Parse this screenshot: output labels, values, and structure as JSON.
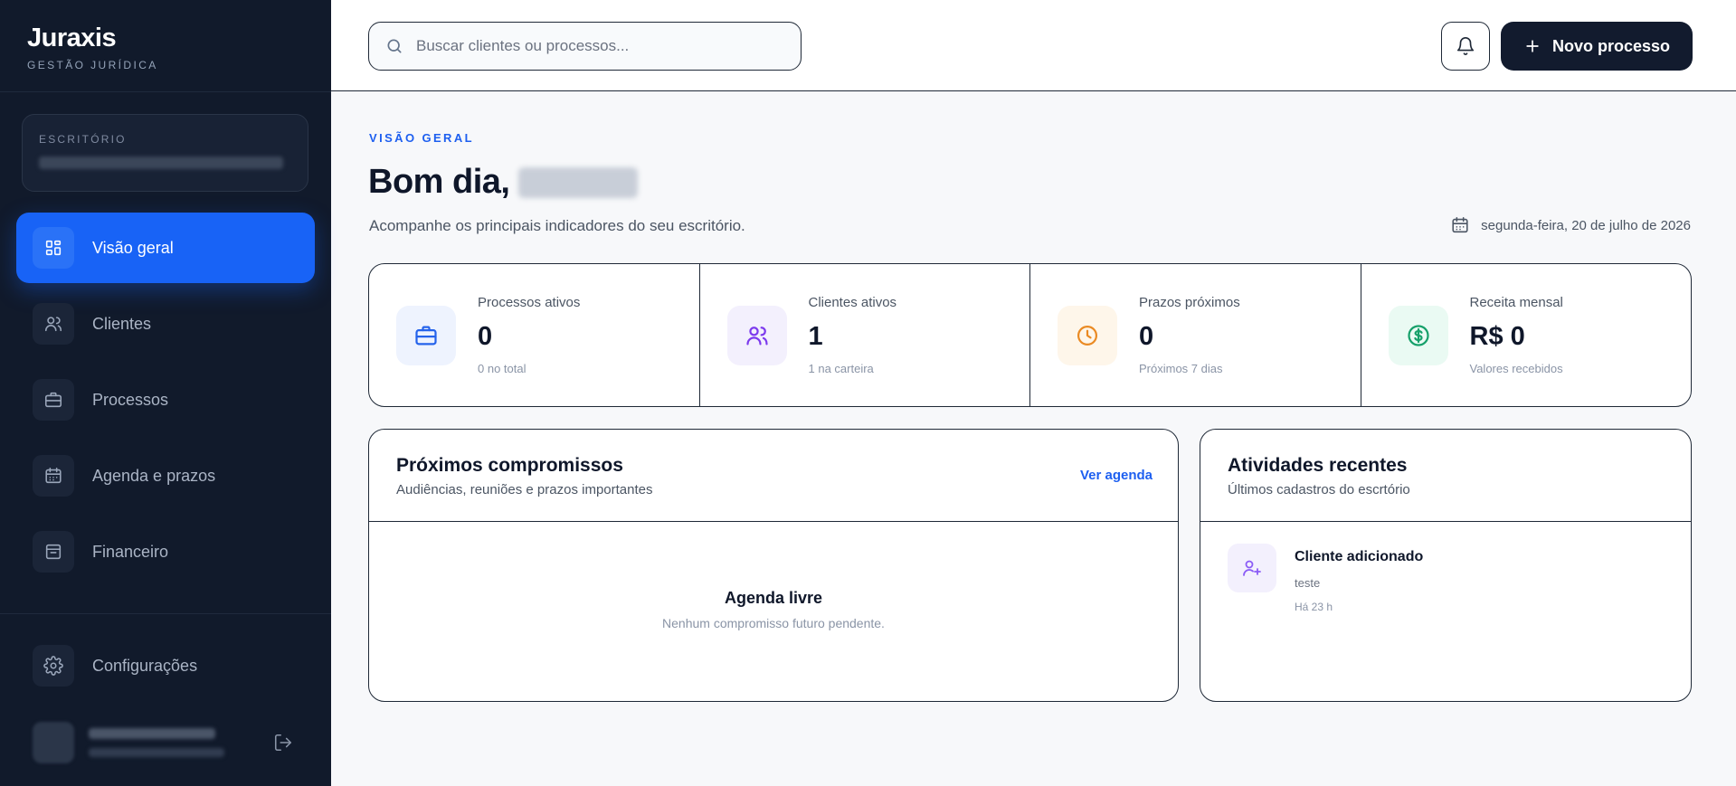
{
  "brand": {
    "name": "Juraxis",
    "subtitle": "GESTÃO JURÍDICA"
  },
  "office": {
    "label": "ESCRITÓRIO"
  },
  "nav": {
    "items": [
      {
        "label": "Visão geral",
        "icon": "layout-grid-icon",
        "active": true
      },
      {
        "label": "Clientes",
        "icon": "users-icon"
      },
      {
        "label": "Processos",
        "icon": "briefcase-icon"
      },
      {
        "label": "Agenda e prazos",
        "icon": "calendar-icon"
      },
      {
        "label": "Financeiro",
        "icon": "wallet-icon"
      }
    ],
    "settings_label": "Configurações"
  },
  "header": {
    "search_placeholder": "Buscar clientes ou processos...",
    "new_button_label": "Novo processo"
  },
  "page": {
    "eyebrow": "VISÃO GERAL",
    "greeting": "Bom dia,",
    "subtitle": "Acompanhe os principais indicadores do seu escritório.",
    "date": "segunda-feira, 20 de julho de 2026"
  },
  "stats": [
    {
      "label": "Processos ativos",
      "value": "0",
      "note": "0 no total",
      "icon": "briefcase-icon",
      "color": "#2563eb",
      "bg": "#eef3fe"
    },
    {
      "label": "Clientes ativos",
      "value": "1",
      "note": "1 na carteira",
      "icon": "users-icon",
      "color": "#7c3aed",
      "bg": "#f3f0fd"
    },
    {
      "label": "Prazos próximos",
      "value": "0",
      "note": "Próximos 7 dias",
      "icon": "clock-icon",
      "color": "#ea8a23",
      "bg": "#fef6ea"
    },
    {
      "label": "Receita mensal",
      "value": "R$ 0",
      "note": "Valores recebidos",
      "icon": "dollar-icon",
      "color": "#16a06a",
      "bg": "#eafaf3"
    }
  ],
  "appointments": {
    "title": "Próximos compromissos",
    "subtitle": "Audiências, reuniões e prazos importantes",
    "link": "Ver agenda",
    "empty_title": "Agenda livre",
    "empty_subtitle": "Nenhum compromisso futuro pendente."
  },
  "activities": {
    "title": "Atividades recentes",
    "subtitle": "Últimos cadastros do escrtório",
    "items": [
      {
        "title": "Cliente adicionado",
        "description": "teste",
        "time": "Há 23 h"
      }
    ]
  }
}
